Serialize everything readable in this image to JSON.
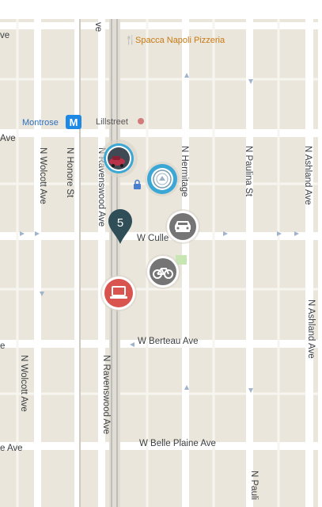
{
  "map": {
    "streets": {
      "ave_top_left": "ve",
      "ave_mid_left": "Ave",
      "ave_small_left": "e",
      "ave_bottom_left": "e Ave",
      "ave_top_ravens": "ve",
      "wolcott_top": "N Wolcott Ave",
      "wolcott_bottom": "N Wolcott Ave",
      "honore": "N Honore St",
      "ravenswood_top": "N Ravenswood Ave",
      "ravenswood_bottom": "N Ravenswood Ave",
      "hermitage": "N Hermitage",
      "paulina_top": "N Paulina St",
      "paulina_bottom": "N Pauli",
      "ashland_top": "N Ashland Ave",
      "ashland_bottom": "N Ashland Ave",
      "cullom": "W Culle",
      "berteau": "W Berteau Ave",
      "belle_plaine": "W Belle Plaine Ave"
    },
    "pois": {
      "pizzeria": "Spacca Napoli Pizzeria",
      "montrose_station": "Montrose",
      "metro_symbol": "M",
      "lillstreet": "Lillstreet"
    },
    "markers": {
      "cluster_count": "5"
    },
    "colors": {
      "land": "#ebe6dc",
      "road": "#ffffff",
      "rail": "#bdbdbd",
      "transit_blue": "#1e88e5",
      "pin_teal": "#2f4e57",
      "marker_gray": "#757575",
      "marker_red": "#d9534f",
      "marker_blue": "#3aa7d5",
      "park_green": "#c8e6b4"
    }
  }
}
